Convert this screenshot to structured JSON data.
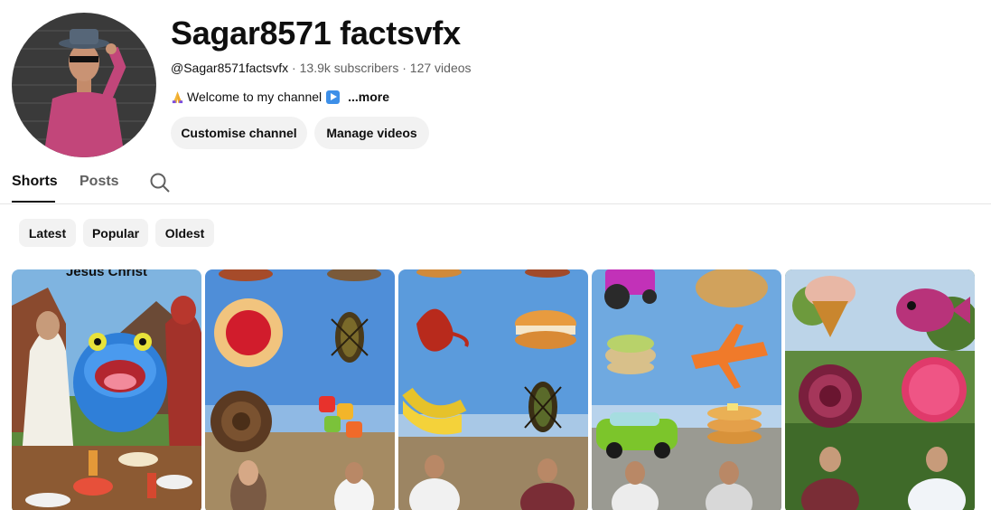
{
  "channel": {
    "title": "Sagar8571 factsvfx",
    "handle": "@Sagar8571factsvfx",
    "separator_1": " · ",
    "subscribers": "13.9k subscribers",
    "separator_2": " · ",
    "videos": "127 videos",
    "description": "Welcome to my channel",
    "more_label": "...more"
  },
  "actions": {
    "customise_label": "Customise channel",
    "manage_label": "Manage videos"
  },
  "tabs": [
    {
      "label": "Shorts",
      "active": true
    },
    {
      "label": "Posts",
      "active": false
    }
  ],
  "filters": [
    {
      "label": "Latest"
    },
    {
      "label": "Popular"
    },
    {
      "label": "Oldest"
    }
  ],
  "shorts": [
    {
      "thumb_caption": "Jesus Christ"
    },
    {
      "thumb_caption": ""
    },
    {
      "thumb_caption": ""
    },
    {
      "thumb_caption": ""
    },
    {
      "thumb_caption": ""
    }
  ],
  "icons": {
    "search": "search-icon",
    "pray": "folded-hands-icon",
    "play": "play-button-icon"
  },
  "colors": {
    "chip_bg": "#f2f2f2",
    "text_primary": "#0f0f0f",
    "text_secondary": "#606060",
    "divider": "#e5e5e5"
  }
}
